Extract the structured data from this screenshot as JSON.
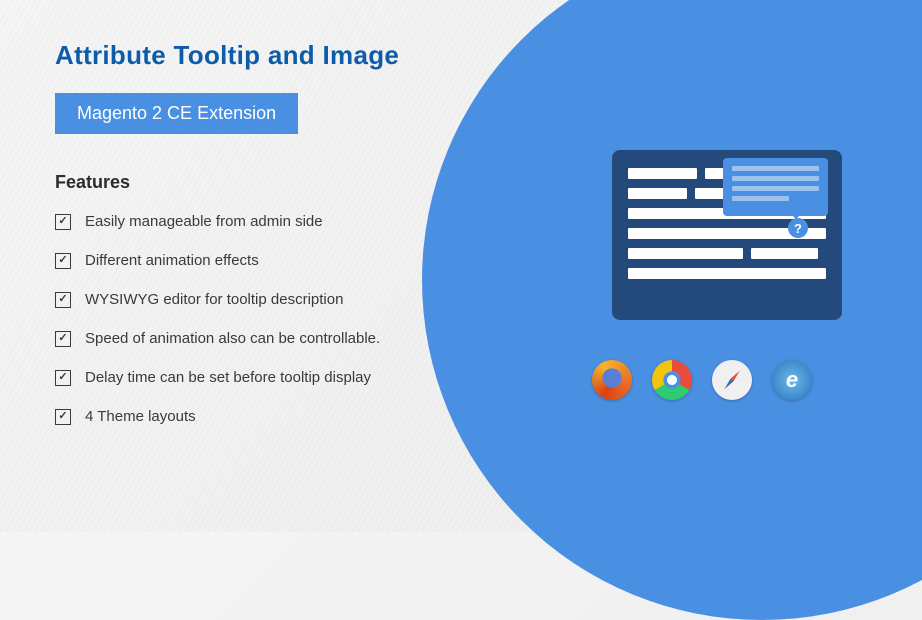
{
  "title": "Attribute Tooltip and Image",
  "badge": "Magento 2 CE Extension",
  "features_heading": "Features",
  "features": [
    "Easily manageable from admin side",
    "Different animation effects",
    "WYSIWYG editor for tooltip description",
    "Speed of animation also can be controllable.",
    "Delay time can be set before tooltip display",
    "4 Theme layouts"
  ],
  "browsers": [
    "firefox",
    "chrome",
    "safari",
    "ie"
  ]
}
